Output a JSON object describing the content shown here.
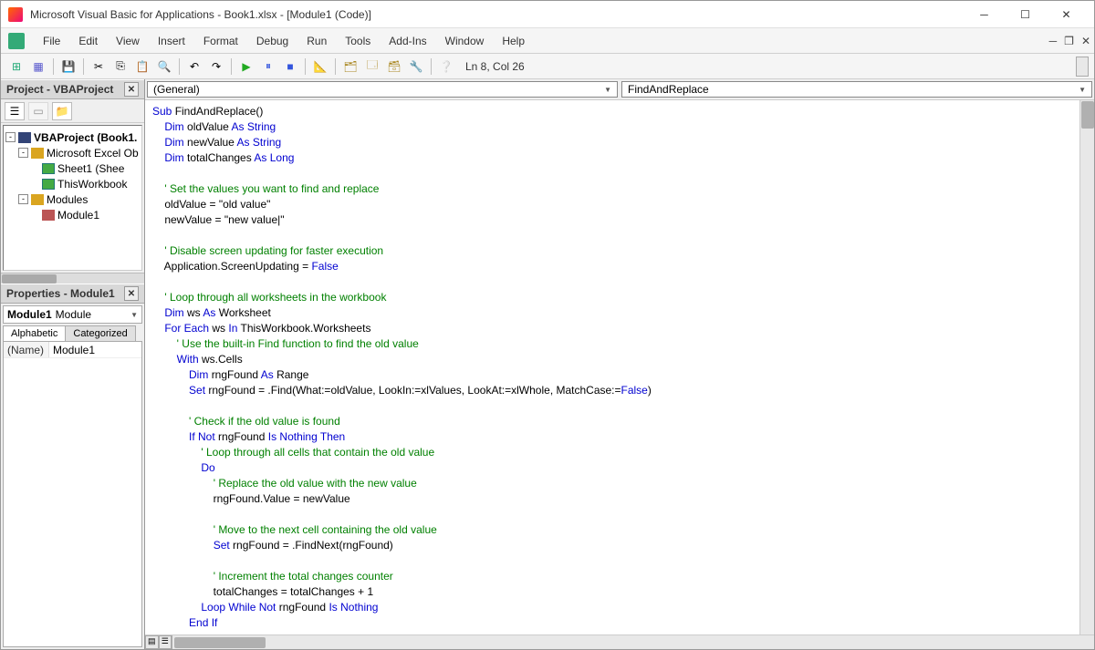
{
  "titlebar": {
    "title": "Microsoft Visual Basic for Applications - Book1.xlsx - [Module1 (Code)]"
  },
  "menubar": {
    "items": [
      "File",
      "Edit",
      "View",
      "Insert",
      "Format",
      "Debug",
      "Run",
      "Tools",
      "Add-Ins",
      "Window",
      "Help"
    ]
  },
  "toolbar": {
    "location": "Ln 8, Col 26"
  },
  "project_panel": {
    "title": "Project - VBAProject",
    "tree": {
      "root": "VBAProject (Book1.",
      "excel_objects": "Microsoft Excel Ob",
      "sheet1": "Sheet1 (Shee",
      "thisworkbook": "ThisWorkbook",
      "modules": "Modules",
      "module1": "Module1"
    }
  },
  "properties_panel": {
    "title": "Properties - Module1",
    "selector_bold": "Module1",
    "selector_type": "Module",
    "tab_alpha": "Alphabetic",
    "tab_cat": "Categorized",
    "name_key": "(Name)",
    "name_value": "Module1"
  },
  "code_combos": {
    "left": "(General)",
    "right": "FindAndReplace"
  },
  "code_lines": [
    {
      "i": 0,
      "segs": [
        {
          "t": "Sub ",
          "c": "kw"
        },
        {
          "t": "FindAndReplace()"
        }
      ]
    },
    {
      "i": 1,
      "segs": [
        {
          "t": "Dim ",
          "c": "kw"
        },
        {
          "t": "oldValue "
        },
        {
          "t": "As String",
          "c": "kw"
        }
      ]
    },
    {
      "i": 1,
      "segs": [
        {
          "t": "Dim ",
          "c": "kw"
        },
        {
          "t": "newValue "
        },
        {
          "t": "As String",
          "c": "kw"
        }
      ]
    },
    {
      "i": 1,
      "segs": [
        {
          "t": "Dim ",
          "c": "kw"
        },
        {
          "t": "totalChanges "
        },
        {
          "t": "As Long",
          "c": "kw"
        }
      ]
    },
    {
      "i": 1,
      "segs": [
        {
          "t": ""
        }
      ]
    },
    {
      "i": 1,
      "segs": [
        {
          "t": "' Set the values you want to find and replace",
          "c": "cm"
        }
      ]
    },
    {
      "i": 1,
      "segs": [
        {
          "t": "oldValue = \"old value\""
        }
      ]
    },
    {
      "i": 1,
      "segs": [
        {
          "t": "newValue = \"new value|\""
        }
      ]
    },
    {
      "i": 1,
      "segs": [
        {
          "t": ""
        }
      ]
    },
    {
      "i": 1,
      "segs": [
        {
          "t": "' Disable screen updating for faster execution",
          "c": "cm"
        }
      ]
    },
    {
      "i": 1,
      "segs": [
        {
          "t": "Application.ScreenUpdating = "
        },
        {
          "t": "False",
          "c": "kw"
        }
      ]
    },
    {
      "i": 1,
      "segs": [
        {
          "t": ""
        }
      ]
    },
    {
      "i": 1,
      "segs": [
        {
          "t": "' Loop through all worksheets in the workbook",
          "c": "cm"
        }
      ]
    },
    {
      "i": 1,
      "segs": [
        {
          "t": "Dim ",
          "c": "kw"
        },
        {
          "t": "ws "
        },
        {
          "t": "As ",
          "c": "kw"
        },
        {
          "t": "Worksheet"
        }
      ]
    },
    {
      "i": 1,
      "segs": [
        {
          "t": "For Each ",
          "c": "kw"
        },
        {
          "t": "ws "
        },
        {
          "t": "In ",
          "c": "kw"
        },
        {
          "t": "ThisWorkbook.Worksheets"
        }
      ]
    },
    {
      "i": 2,
      "segs": [
        {
          "t": "' Use the built-in Find function to find the old value",
          "c": "cm"
        }
      ]
    },
    {
      "i": 2,
      "segs": [
        {
          "t": "With ",
          "c": "kw"
        },
        {
          "t": "ws.Cells"
        }
      ]
    },
    {
      "i": 3,
      "segs": [
        {
          "t": "Dim ",
          "c": "kw"
        },
        {
          "t": "rngFound "
        },
        {
          "t": "As ",
          "c": "kw"
        },
        {
          "t": "Range"
        }
      ]
    },
    {
      "i": 3,
      "segs": [
        {
          "t": "Set ",
          "c": "kw"
        },
        {
          "t": "rngFound = .Find(What:=oldValue, LookIn:=xlValues, LookAt:=xlWhole, MatchCase:="
        },
        {
          "t": "False",
          "c": "kw"
        },
        {
          "t": ")"
        }
      ]
    },
    {
      "i": 3,
      "segs": [
        {
          "t": ""
        }
      ]
    },
    {
      "i": 3,
      "segs": [
        {
          "t": "' Check if the old value is found",
          "c": "cm"
        }
      ]
    },
    {
      "i": 3,
      "segs": [
        {
          "t": "If Not ",
          "c": "kw"
        },
        {
          "t": "rngFound "
        },
        {
          "t": "Is Nothing Then",
          "c": "kw"
        }
      ]
    },
    {
      "i": 4,
      "segs": [
        {
          "t": "' Loop through all cells that contain the old value",
          "c": "cm"
        }
      ]
    },
    {
      "i": 4,
      "segs": [
        {
          "t": "Do",
          "c": "kw"
        }
      ]
    },
    {
      "i": 5,
      "segs": [
        {
          "t": "' Replace the old value with the new value",
          "c": "cm"
        }
      ]
    },
    {
      "i": 5,
      "segs": [
        {
          "t": "rngFound.Value = newValue"
        }
      ]
    },
    {
      "i": 5,
      "segs": [
        {
          "t": ""
        }
      ]
    },
    {
      "i": 5,
      "segs": [
        {
          "t": "' Move to the next cell containing the old value",
          "c": "cm"
        }
      ]
    },
    {
      "i": 5,
      "segs": [
        {
          "t": "Set ",
          "c": "kw"
        },
        {
          "t": "rngFound = .FindNext(rngFound)"
        }
      ]
    },
    {
      "i": 5,
      "segs": [
        {
          "t": ""
        }
      ]
    },
    {
      "i": 5,
      "segs": [
        {
          "t": "' Increment the total changes counter",
          "c": "cm"
        }
      ]
    },
    {
      "i": 5,
      "segs": [
        {
          "t": "totalChanges = totalChanges + 1"
        }
      ]
    },
    {
      "i": 4,
      "segs": [
        {
          "t": "Loop While Not ",
          "c": "kw"
        },
        {
          "t": "rngFound "
        },
        {
          "t": "Is Nothing",
          "c": "kw"
        }
      ]
    },
    {
      "i": 3,
      "segs": [
        {
          "t": "End If",
          "c": "kw"
        }
      ]
    }
  ]
}
